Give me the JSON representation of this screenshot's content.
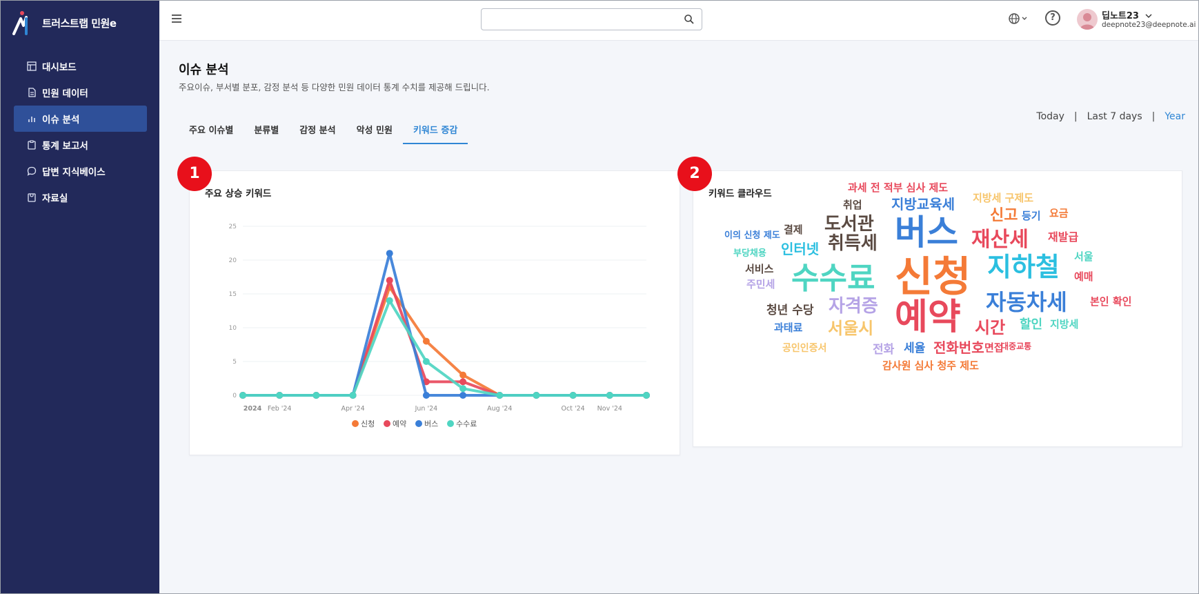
{
  "brand": {
    "name": "트러스트랩 민원e"
  },
  "sidebar": {
    "items": [
      {
        "label": "대시보드",
        "icon": "dashboard-icon"
      },
      {
        "label": "민원 데이터",
        "icon": "document-icon"
      },
      {
        "label": "이슈 분석",
        "icon": "bar-chart-icon",
        "active": true
      },
      {
        "label": "통계 보고서",
        "icon": "clipboard-icon"
      },
      {
        "label": "답변 지식베이스",
        "icon": "chat-icon"
      },
      {
        "label": "자료실",
        "icon": "archive-icon"
      }
    ]
  },
  "header": {
    "search_placeholder": "",
    "user_name": "딥노트23",
    "user_email": "deepnote23@deepnote.ai"
  },
  "page": {
    "title": "이슈 분석",
    "description": "주요이슈, 부서별 분포, 감정 분석 등 다양한 민원 데이터 통계 수치를 제공해 드립니다."
  },
  "tabs": [
    "주요 이슈별",
    "분류별",
    "감정 분석",
    "악성 민원",
    "키워드 증감"
  ],
  "active_tab": "키워드 증감",
  "range": {
    "today": "Today",
    "last7": "Last 7 days",
    "year": "Year",
    "sep": "|"
  },
  "badges": [
    "1",
    "2"
  ],
  "line_card": {
    "title": "주요 상승 키워드"
  },
  "cloud_card": {
    "title": "키워드 클라우드"
  },
  "colors": {
    "sidebar_bg": "#22295a",
    "active_nav": "#2f5099",
    "accent": "#2f86d4",
    "badge": "#e8101b",
    "신청": "#f47a37",
    "예약": "#e8495c",
    "버스": "#3a7fd8",
    "수수료": "#4fd5c2"
  },
  "chart_data": {
    "type": "line",
    "x": [
      "2024-01",
      "2024-02",
      "2024-03",
      "2024-04",
      "2024-05",
      "2024-06",
      "2024-07",
      "2024-08",
      "2024-09",
      "2024-10",
      "2024-11",
      "2024-12"
    ],
    "x_tick_labels": [
      "2024",
      "Feb '24",
      "Apr '24",
      "Jun '24",
      "Aug '24",
      "Oct '24",
      "Nov '24"
    ],
    "ylim": [
      0,
      25
    ],
    "y_ticks": [
      "0",
      "5",
      "10",
      "15",
      "20",
      "25"
    ],
    "grid": true,
    "legend": "bottom",
    "series": [
      {
        "name": "신청",
        "values": [
          0,
          0,
          0,
          0,
          16,
          8,
          3,
          0,
          0,
          0,
          0,
          0
        ]
      },
      {
        "name": "예약",
        "values": [
          0,
          0,
          0,
          0,
          17,
          2,
          2,
          0,
          0,
          0,
          0,
          0
        ]
      },
      {
        "name": "버스",
        "values": [
          0,
          0,
          0,
          0,
          21,
          0,
          0,
          0,
          0,
          0,
          0,
          0
        ]
      },
      {
        "name": "수수료",
        "values": [
          0,
          0,
          0,
          0,
          14,
          5,
          1,
          0,
          0,
          0,
          0,
          0
        ]
      }
    ]
  },
  "word_cloud": [
    {
      "text": "신청",
      "size": 60,
      "color": "#f47a37"
    },
    {
      "text": "예약",
      "size": 52,
      "color": "#e8495c"
    },
    {
      "text": "버스",
      "size": 50,
      "color": "#3a7fd8"
    },
    {
      "text": "수수료",
      "size": 44,
      "color": "#4fd5c2"
    },
    {
      "text": "지하철",
      "size": 38,
      "color": "#2bbfe0"
    },
    {
      "text": "자동차세",
      "size": 32,
      "color": "#3a7fd8"
    },
    {
      "text": "재산세",
      "size": 30,
      "color": "#e8495c"
    },
    {
      "text": "취득세",
      "size": 26,
      "color": "#5a4a42"
    },
    {
      "text": "도서관",
      "size": 26,
      "color": "#5a4a42"
    },
    {
      "text": "자격증",
      "size": 26,
      "color": "#b5a3e6"
    },
    {
      "text": "서울시",
      "size": 24,
      "color": "#f7c56b"
    },
    {
      "text": "시간",
      "size": 24,
      "color": "#e8495c"
    },
    {
      "text": "신고",
      "size": 22,
      "color": "#f47a37"
    },
    {
      "text": "인터넷",
      "size": 20,
      "color": "#2bbfe0"
    },
    {
      "text": "지방교육세",
      "size": 20,
      "color": "#3a7fd8"
    },
    {
      "text": "전화번호",
      "size": 20,
      "color": "#e8495c"
    },
    {
      "text": "할인",
      "size": 18,
      "color": "#4fd5c2"
    },
    {
      "text": "청년 수당",
      "size": 17,
      "color": "#5a4a42"
    },
    {
      "text": "세율",
      "size": 17,
      "color": "#3a7fd8"
    },
    {
      "text": "전화",
      "size": 17,
      "color": "#b5a3e6"
    },
    {
      "text": "재발급",
      "size": 16,
      "color": "#e8495c"
    },
    {
      "text": "본인 확인",
      "size": 15,
      "color": "#e8495c"
    },
    {
      "text": "감사원 심사 청주 제도",
      "size": 15,
      "color": "#f47a37"
    },
    {
      "text": "과세 전 적부 심사 제도",
      "size": 15,
      "color": "#e8495c"
    },
    {
      "text": "지방세 구제도",
      "size": 15,
      "color": "#f7c56b"
    },
    {
      "text": "등기",
      "size": 15,
      "color": "#3a7fd8"
    },
    {
      "text": "요금",
      "size": 15,
      "color": "#f47a37"
    },
    {
      "text": "서울",
      "size": 15,
      "color": "#4fd5c2"
    },
    {
      "text": "예매",
      "size": 15,
      "color": "#e8495c"
    },
    {
      "text": "지방세",
      "size": 15,
      "color": "#4fd5c2"
    },
    {
      "text": "결제",
      "size": 15,
      "color": "#5a4a42"
    },
    {
      "text": "취업",
      "size": 15,
      "color": "#5a4a42"
    },
    {
      "text": "서비스",
      "size": 15,
      "color": "#5a4a42"
    },
    {
      "text": "주민세",
      "size": 15,
      "color": "#b5a3e6"
    },
    {
      "text": "과태료",
      "size": 15,
      "color": "#3a7fd8"
    },
    {
      "text": "공인인증서",
      "size": 14,
      "color": "#f7c56b"
    },
    {
      "text": "면접",
      "size": 15,
      "color": "#e8495c"
    },
    {
      "text": "대중교통",
      "size": 12,
      "color": "#e8495c"
    },
    {
      "text": "이의 신청 제도",
      "size": 13,
      "color": "#3a7fd8"
    },
    {
      "text": "부당채용",
      "size": 13,
      "color": "#4fd5c2"
    }
  ]
}
